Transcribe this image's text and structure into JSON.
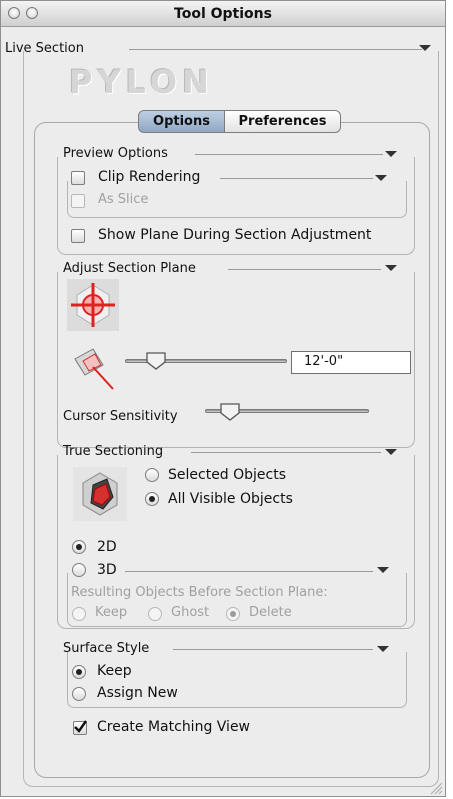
{
  "window": {
    "title": "Tool Options"
  },
  "live_section": {
    "label": "Live Section",
    "logo": "PYLON"
  },
  "tabs": [
    {
      "label": "Options",
      "selected": true
    },
    {
      "label": "Preferences",
      "selected": false
    }
  ],
  "preview_options": {
    "title": "Preview Options",
    "clip_rendering": {
      "label": "Clip Rendering",
      "checked": false
    },
    "as_slice": {
      "label": "As Slice",
      "checked": false,
      "disabled": true
    },
    "show_plane": {
      "label": "Show Plane During Section Adjustment",
      "checked": false
    }
  },
  "adjust_section_plane": {
    "title": "Adjust Section Plane",
    "offset_value": "12'-0\"",
    "cursor_sensitivity_label": "Cursor Sensitivity"
  },
  "true_sectioning": {
    "title": "True Sectioning",
    "selected_objects": "Selected Objects",
    "all_visible_objects": "All Visible Objects",
    "option_2d": "2D",
    "option_3d": "3D",
    "resulting_label": "Resulting Objects Before Section Plane:",
    "keep": "Keep",
    "ghost": "Ghost",
    "delete": "Delete"
  },
  "surface_style": {
    "title": "Surface Style",
    "keep": "Keep",
    "assign_new": "Assign New"
  },
  "create_matching_view": {
    "label": "Create Matching View",
    "checked": true
  },
  "icons": [
    "close-icon",
    "minimize-icon",
    "disclosure-triangle-icon",
    "crosshair-target-icon",
    "section-plane-icon",
    "section-solid-icon",
    "resize-grip-icon"
  ]
}
